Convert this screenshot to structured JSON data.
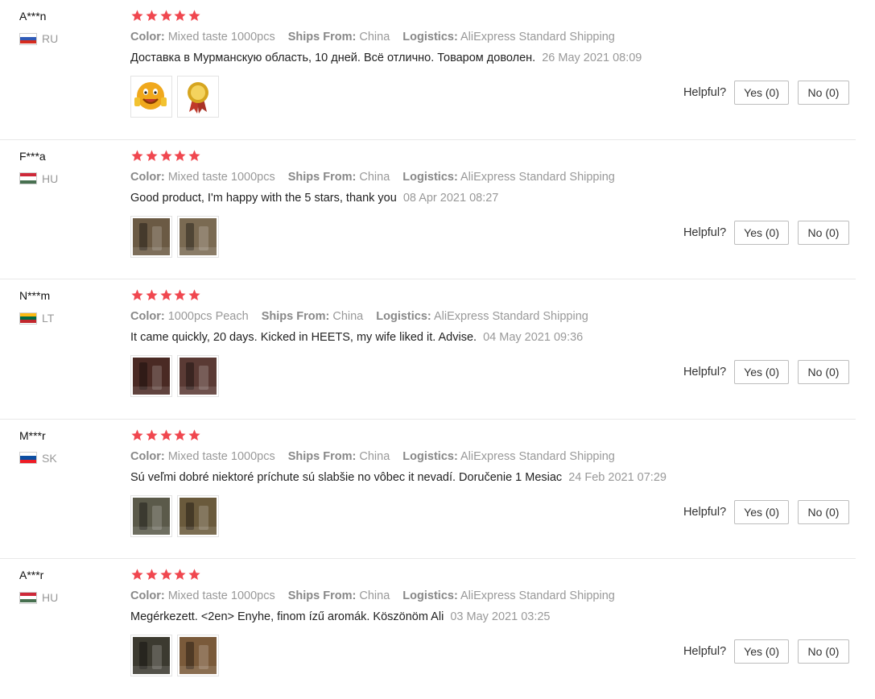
{
  "labels": {
    "color": "Color:",
    "ships_from": "Ships From:",
    "logistics": "Logistics:",
    "helpful": "Helpful?"
  },
  "colors": {
    "star": "#f0474f",
    "muted_text": "#999999"
  },
  "reviews": [
    {
      "user": "A***n",
      "country": "RU",
      "flag_colors": [
        "#ffffff",
        "#2f5bb7",
        "#d52b1e"
      ],
      "rating": 5,
      "color_value": "Mixed taste 1000pcs",
      "ships_from": "China",
      "logistics": "AliExpress Standard Shipping",
      "text": "Доставка в Мурманскую область, 10 дней. Всё отлично. Товаром доволен.",
      "date": "26 May 2021 08:09",
      "photos": [
        {
          "icon": "smiley-thumbs-up-emoji-icon",
          "tone": "#f0a81c"
        },
        {
          "icon": "gold-medal-ribbon-icon",
          "tone": "#d6a51f"
        }
      ],
      "yes": "Yes (0)",
      "no": "No (0)"
    },
    {
      "user": "F***a",
      "country": "HU",
      "flag_colors": [
        "#ce2939",
        "#ffffff",
        "#477050"
      ],
      "rating": 5,
      "color_value": "Mixed taste 1000pcs",
      "ships_from": "China",
      "logistics": "AliExpress Standard Shipping",
      "text": "Good product, I'm happy with the 5 stars, thank you",
      "date": "08 Apr 2021 08:27",
      "photos": [
        {
          "icon": "product-photo-icon",
          "tone": "#6b5a44"
        },
        {
          "icon": "product-photo-icon",
          "tone": "#7a6a52"
        }
      ],
      "yes": "Yes (0)",
      "no": "No (0)"
    },
    {
      "user": "N***m",
      "country": "LT",
      "flag_colors": [
        "#fdb913",
        "#006a44",
        "#c1272d"
      ],
      "rating": 5,
      "color_value": "1000pcs Peach",
      "ships_from": "China",
      "logistics": "AliExpress Standard Shipping",
      "text": "It came quickly, 20 days. Kicked in HEETS, my wife liked it. Advise.",
      "date": "04 May 2021 09:36",
      "photos": [
        {
          "icon": "product-photo-icon",
          "tone": "#4a2a24"
        },
        {
          "icon": "product-photo-icon",
          "tone": "#5a3a34"
        }
      ],
      "yes": "Yes (0)",
      "no": "No (0)"
    },
    {
      "user": "M***r",
      "country": "SK",
      "flag_colors": [
        "#ffffff",
        "#0b4ea2",
        "#ee1c25"
      ],
      "rating": 5,
      "color_value": "Mixed taste 1000pcs",
      "ships_from": "China",
      "logistics": "AliExpress Standard Shipping",
      "text": "Sú veľmi dobré niektoré príchute sú slabšie no vôbec it nevadí. Doručenie 1 Mesiac",
      "date": "24 Feb 2021 07:29",
      "photos": [
        {
          "icon": "product-photo-icon",
          "tone": "#5b5a4a"
        },
        {
          "icon": "product-photo-icon",
          "tone": "#6a5a3c"
        }
      ],
      "yes": "Yes (0)",
      "no": "No (0)"
    },
    {
      "user": "A***r",
      "country": "HU",
      "flag_colors": [
        "#ce2939",
        "#ffffff",
        "#477050"
      ],
      "rating": 5,
      "color_value": "Mixed taste 1000pcs",
      "ships_from": "China",
      "logistics": "AliExpress Standard Shipping",
      "text": "Megérkezett. <2en> Enyhe, finom ízű aromák. Köszönöm Ali",
      "date": "03 May 2021 03:25",
      "photos": [
        {
          "icon": "product-photo-icon",
          "tone": "#3c3a30"
        },
        {
          "icon": "product-photo-icon",
          "tone": "#7a5a3a"
        }
      ],
      "yes": "Yes (0)",
      "no": "No (0)"
    }
  ]
}
